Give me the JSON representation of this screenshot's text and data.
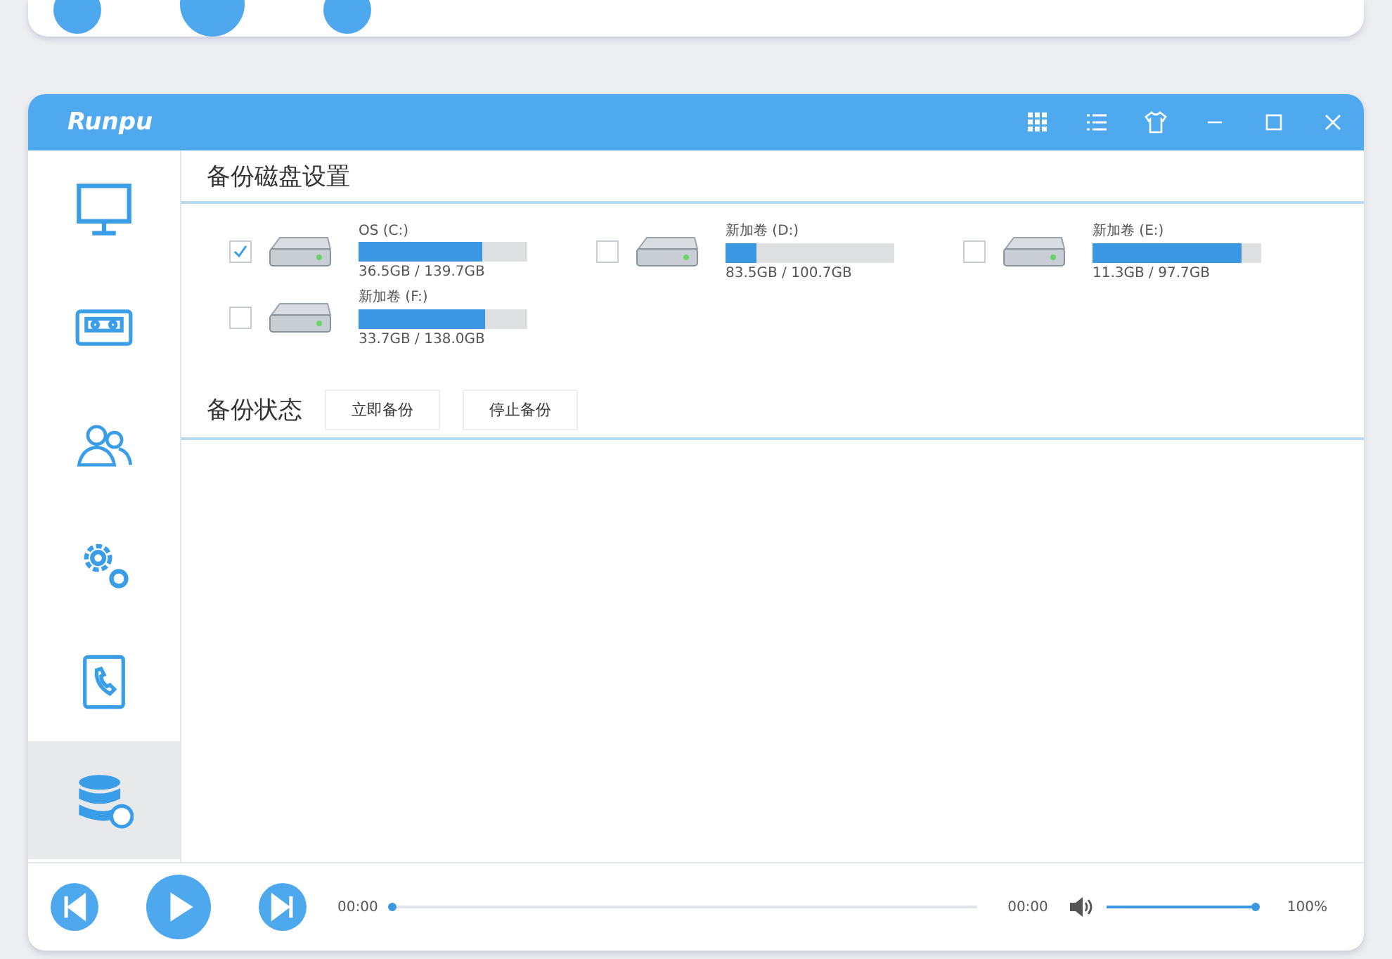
{
  "window": {
    "logo": "Runpu"
  },
  "sidebar": {
    "items": [
      {
        "selected": false
      },
      {
        "selected": false
      },
      {
        "selected": false
      },
      {
        "selected": false
      },
      {
        "selected": false
      },
      {
        "selected": true
      }
    ]
  },
  "disk_settings": {
    "title": "备份磁盘设置",
    "drives": [
      {
        "name": "OS (C:)",
        "checked": true,
        "level": 0.73,
        "size": "36.5GB / 139.7GB"
      },
      {
        "name": "新加卷 (D:)",
        "checked": false,
        "level": 0.18,
        "size": "83.5GB / 100.7GB"
      },
      {
        "name": "新加卷 (E:)",
        "checked": false,
        "level": 0.88,
        "size": "11.3GB / 97.7GB"
      },
      {
        "name": "新加卷 (F:)",
        "checked": false,
        "level": 0.75,
        "size": "33.7GB / 138.0GB"
      }
    ]
  },
  "backup_status": {
    "title": "备份状态",
    "buttons": [
      "立即备份",
      "停止备份"
    ]
  },
  "player": {
    "elapsed": "00:00",
    "progress": {
      "level": 0.0
    },
    "total": "00:00",
    "volume": {
      "level": 1.0
    },
    "volume_reading": "100%"
  }
}
